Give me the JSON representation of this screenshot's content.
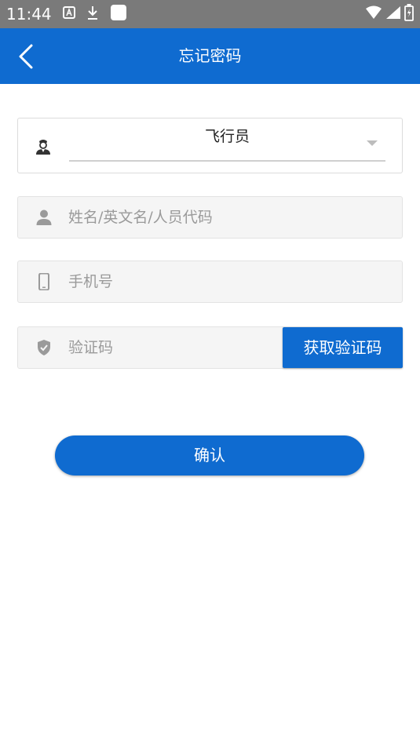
{
  "status_bar": {
    "time": "11:44",
    "left_icons": [
      "text-a-icon",
      "download-icon",
      "app-square-icon"
    ],
    "right_icons": [
      "wifi-icon",
      "signal-icon",
      "battery-charging-icon"
    ]
  },
  "app_bar": {
    "title": "忘记密码",
    "back_icon": "chevron-left-icon",
    "color": "#0f6bd0"
  },
  "role_select": {
    "icon": "pilot-icon",
    "value": "飞行员",
    "dropdown_icon": "caret-down-icon"
  },
  "name_field": {
    "icon": "person-icon",
    "placeholder": "姓名/英文名/人员代码",
    "value": ""
  },
  "phone_field": {
    "icon": "phone-icon",
    "placeholder": "手机号",
    "value": ""
  },
  "code_field": {
    "icon": "shield-icon",
    "placeholder": "验证码",
    "value": "",
    "button_label": "获取验证码"
  },
  "confirm_button": {
    "label": "确认"
  }
}
